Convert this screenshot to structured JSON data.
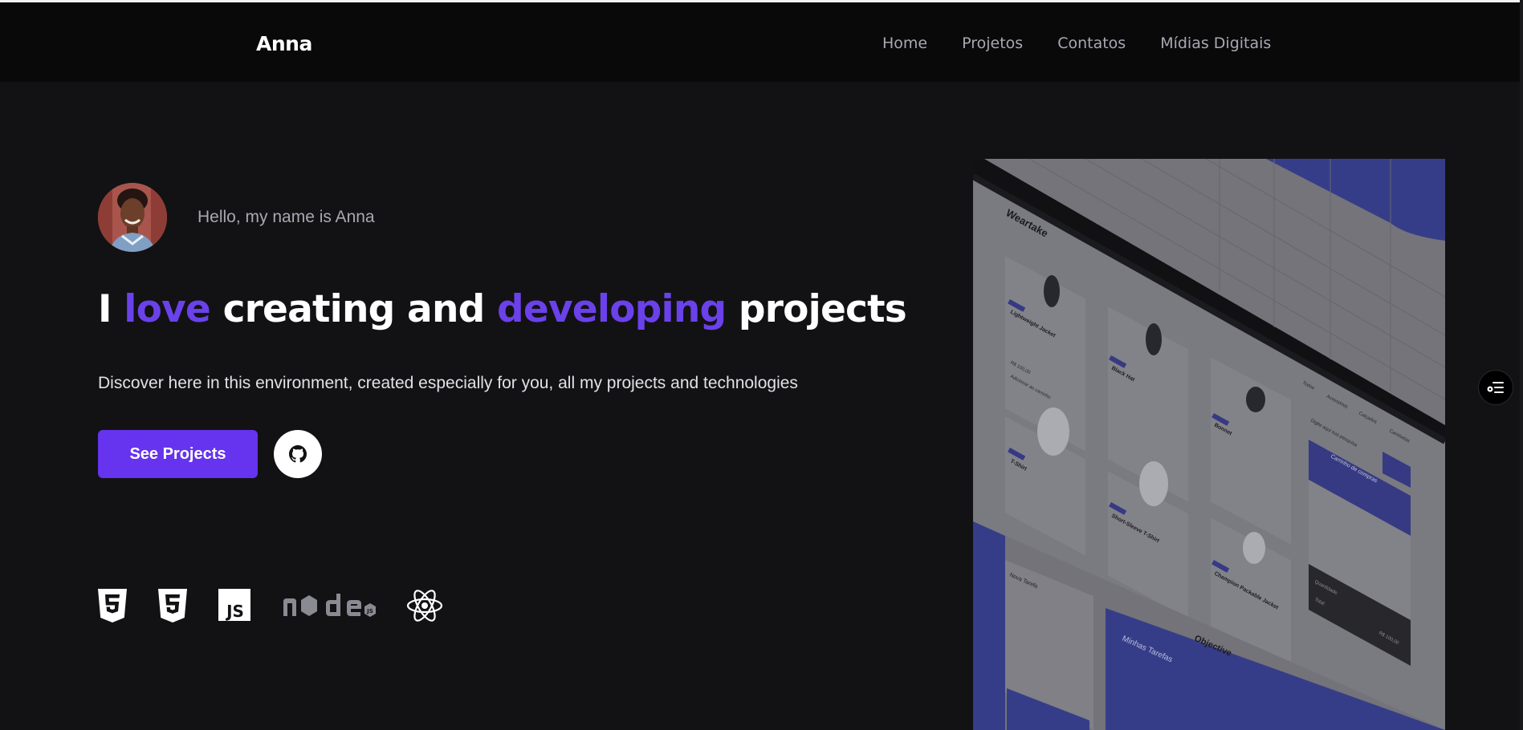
{
  "header": {
    "brand": "Anna",
    "nav": [
      "Home",
      "Projetos",
      "Contatos",
      "Mídias Digitais"
    ]
  },
  "hero": {
    "greeting": "Hello, my name is Anna",
    "headline": {
      "part1": "I",
      "accent1": "love",
      "part2": "creating and",
      "accent2": "developing",
      "part3": "projects"
    },
    "lead": "Discover here in this environment, created especially for you, all my projects and technologies",
    "cta_label": "See Projects"
  },
  "tech_icons": [
    "html5-icon",
    "css3-icon",
    "javascript-icon",
    "nodejs-icon",
    "react-icon"
  ],
  "mockup": {
    "store_title": "Weartake",
    "products": [
      "Lightweight Jacket",
      "Black Hat",
      "Bonnet",
      "T-Shirt",
      "Short-Sleeve T-Shirt",
      "Champion Packable Jacket"
    ],
    "price_label": "R$ 100,00",
    "add_label": "Adicionar ao carrinho",
    "cart_title": "Carrinho de compras",
    "filters": [
      "Todos",
      "Acessórios",
      "Calçados",
      "Camisetas"
    ],
    "search_placeholder": "Digite aqui sua pesquisa",
    "task_title": "Objective",
    "task_subtitle": "Minhas Tarefas",
    "task_form_title": "Nova Tarefa",
    "cart_total": "R$ 100,00",
    "cart_qty_label": "Quantidade:",
    "cart_total_label": "Total:"
  },
  "colors": {
    "background": "#121214",
    "topbar": "#09090a",
    "accent": "#6b41ea",
    "button": "#6633ee",
    "muted": "#a8a8b3"
  }
}
